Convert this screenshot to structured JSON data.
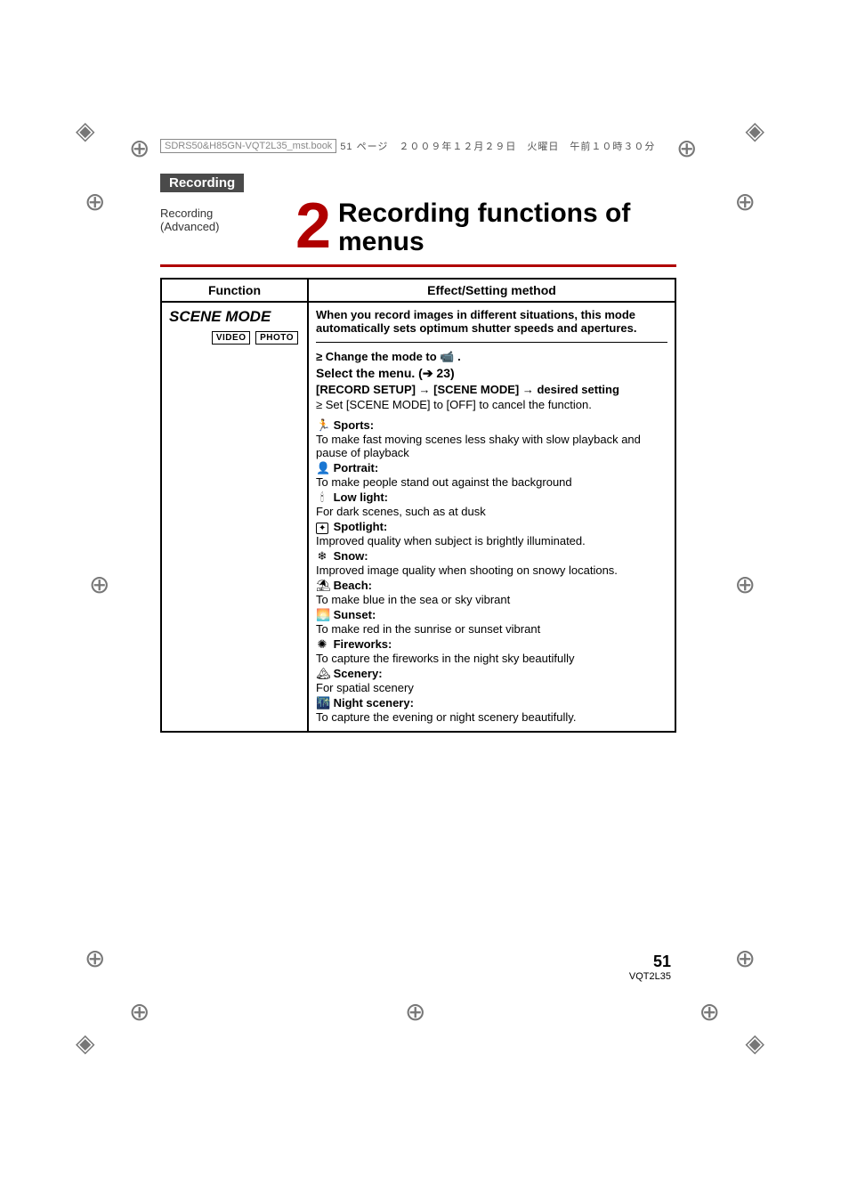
{
  "file_header": {
    "filename": "SDRS50&H85GN-VQT2L35_mst.book",
    "rest": "51 ページ　２００９年１２月２９日　火曜日　午前１０時３０分"
  },
  "section_tab": "Recording",
  "breadcrumb_line1": "Recording",
  "breadcrumb_line2": "(Advanced)",
  "chapter_number": "2",
  "chapter_title": "Recording functions of menus",
  "table": {
    "head_function": "Function",
    "head_effect": "Effect/Setting method",
    "function_name": "SCENE MODE",
    "badges": [
      "VIDEO",
      "PHOTO"
    ],
    "intro": "When you record images in different situations, this mode automatically sets optimum shutter speeds and apertures.",
    "step_change_mode_prefix": "≥ Change the mode to ",
    "step_change_mode_suffix": " .",
    "select_menu_text": "Select the menu. (",
    "select_menu_arrow": "➔",
    "select_menu_page": " 23)",
    "menu_path": "[RECORD SETUP] → [SCENE MODE] → desired setting",
    "cancel_note": "≥ Set [SCENE MODE] to [OFF] to cancel the function.",
    "modes": [
      {
        "icon": "🏃",
        "name": "Sports:",
        "desc": "To make fast moving scenes less shaky with slow playback and pause of playback"
      },
      {
        "icon": "👤",
        "name": "Portrait:",
        "desc": "To make people stand out against the background"
      },
      {
        "icon": "🕯",
        "name": "Low light:",
        "desc": "For dark scenes, such as at dusk"
      },
      {
        "icon": "",
        "boxed": "✦",
        "name": "Spotlight:",
        "desc": "Improved quality when subject is brightly illuminated."
      },
      {
        "icon": "❄",
        "name": "Snow:",
        "desc": "Improved image quality when shooting on snowy locations."
      },
      {
        "icon": "⛱",
        "name": "Beach:",
        "desc": "To make blue in the sea or sky vibrant"
      },
      {
        "icon": "🌅",
        "name": "Sunset:",
        "desc": "To make red in the sunrise or sunset vibrant"
      },
      {
        "icon": "✺",
        "name": "Fireworks:",
        "desc": "To capture the fireworks in the night sky beautifully"
      },
      {
        "icon": "🏔",
        "name": "Scenery:",
        "desc": "For spatial scenery"
      },
      {
        "icon": "🌃",
        "name": "Night scenery:",
        "desc": "To capture the evening or night scenery beautifully."
      }
    ]
  },
  "footer": {
    "page_number": "51",
    "doc_code": "VQT2L35"
  }
}
